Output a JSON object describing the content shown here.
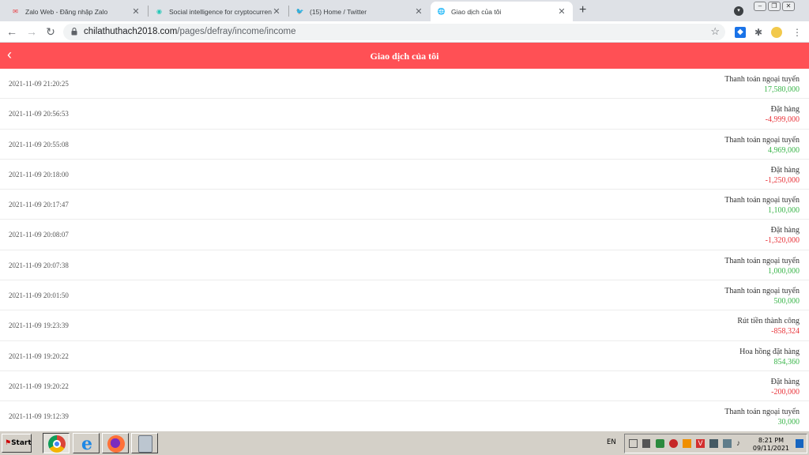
{
  "browser": {
    "tabs": [
      {
        "title": "Zalo Web - Đăng nhập Zalo",
        "fav_color": "#e8383d",
        "fav_glyph": "✉"
      },
      {
        "title": "Social intelligence for cryptocurrencies",
        "fav_color": "#1fc7b6",
        "fav_glyph": "◉"
      },
      {
        "title": "(15) Home / Twitter",
        "fav_color": "#1da1f2",
        "fav_glyph": "🐦"
      },
      {
        "title": "Giao dịch của tôi",
        "fav_color": "#5f6368",
        "fav_glyph": "🌐"
      }
    ],
    "new_tab_glyph": "+",
    "url_host": "chilathuthach2018.com",
    "url_path": "/pages/defray/income/income"
  },
  "app": {
    "title": "Giao dịch của tôi",
    "back_glyph": "‹"
  },
  "transactions": [
    {
      "date": "2021-11-09 21:20:25",
      "type": "Thanh toán ngoại tuyến",
      "amount": "17,580,000",
      "sign": "pos"
    },
    {
      "date": "2021-11-09 20:56:53",
      "type": "Đặt hàng",
      "amount": "-4,999,000",
      "sign": "neg"
    },
    {
      "date": "2021-11-09 20:55:08",
      "type": "Thanh toán ngoại tuyến",
      "amount": "4,969,000",
      "sign": "pos"
    },
    {
      "date": "2021-11-09 20:18:00",
      "type": "Đặt hàng",
      "amount": "-1,250,000",
      "sign": "neg"
    },
    {
      "date": "2021-11-09 20:17:47",
      "type": "Thanh toán ngoại tuyến",
      "amount": "1,100,000",
      "sign": "pos"
    },
    {
      "date": "2021-11-09 20:08:07",
      "type": "Đặt hàng",
      "amount": "-1,320,000",
      "sign": "neg"
    },
    {
      "date": "2021-11-09 20:07:38",
      "type": "Thanh toán ngoại tuyến",
      "amount": "1,000,000",
      "sign": "pos"
    },
    {
      "date": "2021-11-09 20:01:50",
      "type": "Thanh toán ngoại tuyến",
      "amount": "500,000",
      "sign": "pos"
    },
    {
      "date": "2021-11-09 19:23:39",
      "type": "Rút tiền thành công",
      "amount": "-858,324",
      "sign": "neg"
    },
    {
      "date": "2021-11-09 19:20:22",
      "type": "Hoa hồng đặt hàng",
      "amount": "854,360",
      "sign": "pos"
    },
    {
      "date": "2021-11-09 19:20:22",
      "type": "Đặt hàng",
      "amount": "-200,000",
      "sign": "neg"
    },
    {
      "date": "2021-11-09 19:12:39",
      "type": "Thanh toán ngoại tuyến",
      "amount": "30,000",
      "sign": "pos"
    }
  ],
  "colors": {
    "accent": "#ff5055",
    "positive": "#3ab54a",
    "negative": "#e8343a"
  },
  "taskbar": {
    "start_label": "Start",
    "language": "EN",
    "time": "8:21 PM",
    "date": "09/11/2021"
  }
}
